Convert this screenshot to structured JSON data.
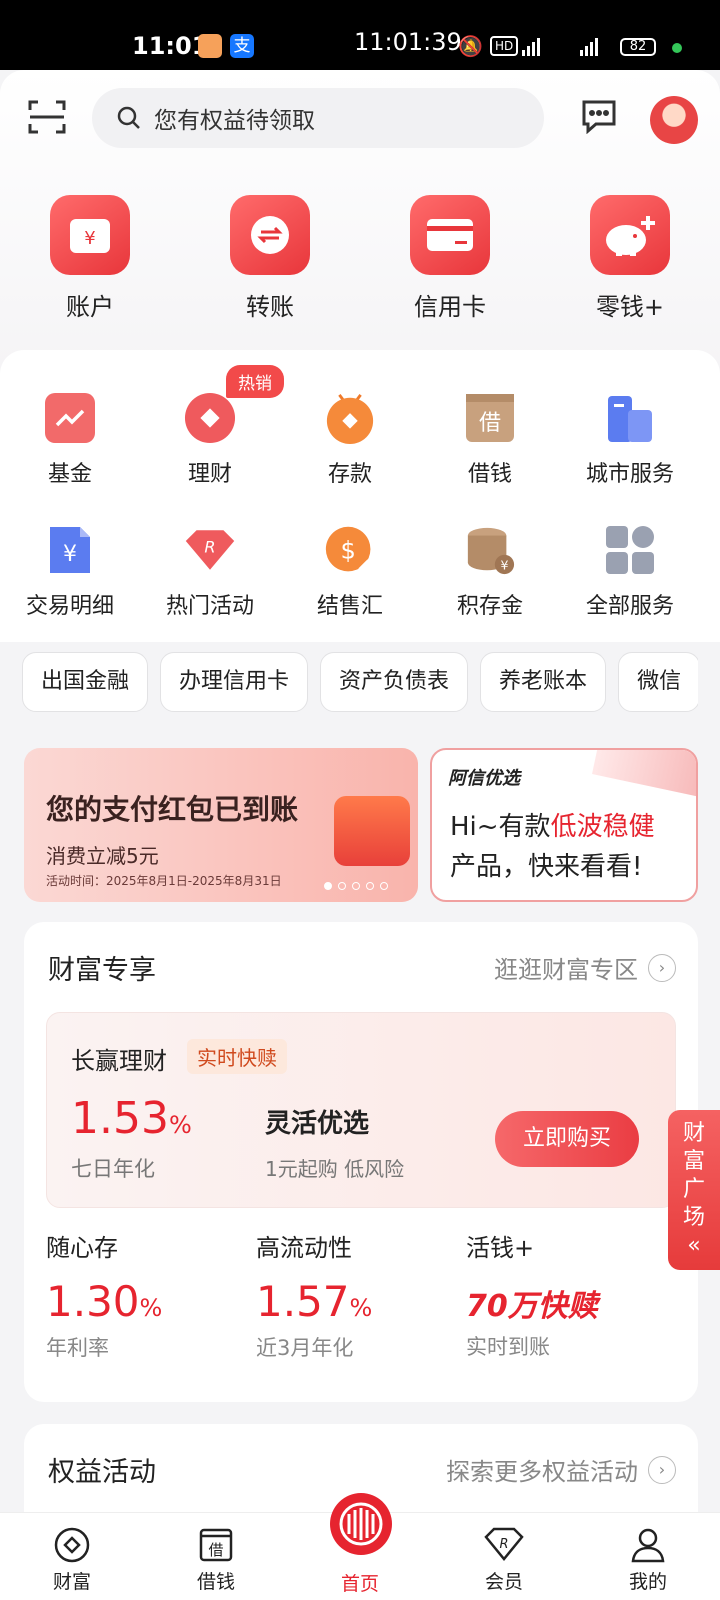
{
  "status": {
    "time": "11:01",
    "center_time": "11:01:39",
    "battery": "82"
  },
  "header": {
    "search_placeholder": "您有权益待领取"
  },
  "main_actions": [
    {
      "label": "账户",
      "icon": "account-wallet-icon"
    },
    {
      "label": "转账",
      "icon": "transfer-icon"
    },
    {
      "label": "信用卡",
      "icon": "credit-card-icon"
    },
    {
      "label": "零钱+",
      "icon": "piggy-bank-icon"
    }
  ],
  "services_row1": [
    {
      "label": "基金",
      "icon": "fund-chart-icon"
    },
    {
      "label": "理财",
      "icon": "finance-diamond-icon"
    },
    {
      "label": "存款",
      "icon": "deposit-icon"
    },
    {
      "label": "借钱",
      "icon": "borrow-icon",
      "glyph": "借"
    },
    {
      "label": "城市服务",
      "icon": "city-service-icon"
    }
  ],
  "services_row2": [
    {
      "label": "交易明细",
      "icon": "transaction-detail-icon"
    },
    {
      "label": "热门活动",
      "icon": "hot-activity-icon"
    },
    {
      "label": "结售汇",
      "icon": "forex-icon"
    },
    {
      "label": "积存金",
      "icon": "gold-coins-icon"
    },
    {
      "label": "全部服务",
      "icon": "all-services-icon"
    }
  ],
  "hot_badge": "热销",
  "chips": [
    "出国金融",
    "办理信用卡",
    "资产负债表",
    "养老账本",
    "微信"
  ],
  "banner_left": {
    "title": "您的支付红包已到账",
    "subtitle": "消费立减5元",
    "period": "活动时间：2025年8月1日-2025年8月31日"
  },
  "banner_right": {
    "brand": "阿信优选",
    "line1_prefix": "Hi~有款",
    "line1_highlight": "低波稳健",
    "line2": "产品，快来看看!"
  },
  "wealth": {
    "title": "财富专享",
    "more": "逛逛财富专区",
    "featured": {
      "name": "长赢理财",
      "tag": "实时快赎",
      "rate": "1.53",
      "rate_unit": "%",
      "rate_label": "七日年化",
      "product": "灵活优选",
      "desc": "1元起购 低风险",
      "buy": "立即购买"
    },
    "products": [
      {
        "name": "随心存",
        "value": "1.30",
        "unit": "%",
        "sub": "年利率"
      },
      {
        "name": "高流动性",
        "value": "1.57",
        "unit": "%",
        "sub": "近3月年化"
      },
      {
        "name": "活钱+",
        "highlight": "70万快赎",
        "sub": "实时到账"
      }
    ]
  },
  "side_tab": "财富广场",
  "rights": {
    "title": "权益活动",
    "more": "探索更多权益活动"
  },
  "bottom_nav": [
    {
      "label": "财富",
      "icon": "wealth-icon"
    },
    {
      "label": "借钱",
      "icon": "borrow-nav-icon"
    },
    {
      "label": "首页",
      "icon": "home-logo-icon"
    },
    {
      "label": "会员",
      "icon": "member-icon"
    },
    {
      "label": "我的",
      "icon": "profile-icon"
    }
  ],
  "colors": {
    "accent": "#e6242f",
    "icon_red": "#f0444a"
  }
}
